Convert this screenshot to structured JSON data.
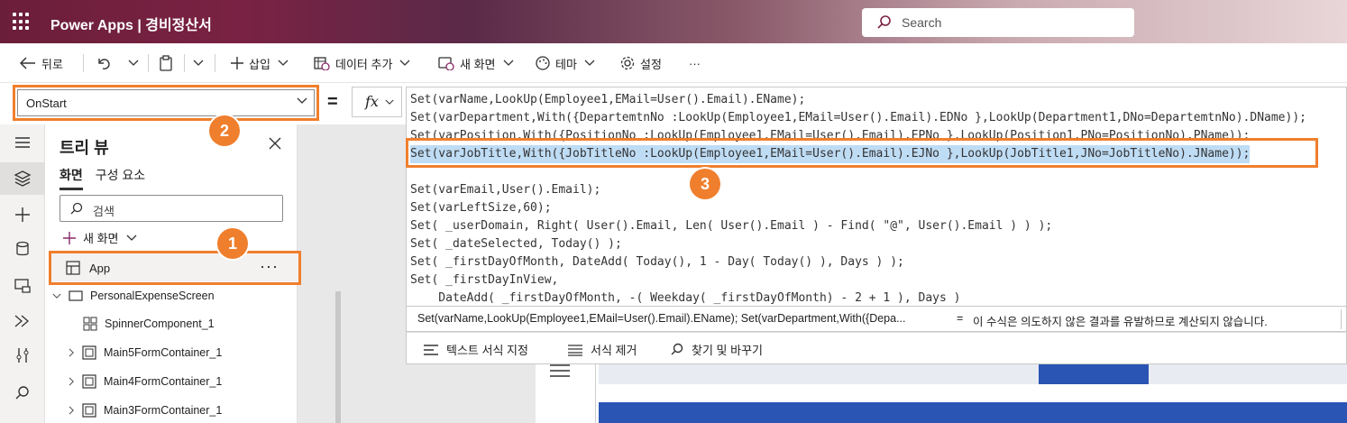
{
  "header": {
    "app_name": "Power Apps  |  경비정산서",
    "search_placeholder": "Search"
  },
  "toolbar": {
    "back": "뒤로",
    "insert": "삽입",
    "add_data": "데이터 추가",
    "new_screen": "새 화면",
    "theme": "테마",
    "settings": "설정",
    "more": "···"
  },
  "formula": {
    "property": "OnStart",
    "equals": "=",
    "fx": "fx"
  },
  "tree": {
    "title": "트리 뷰",
    "tab_screens": "화면",
    "tab_components": "구성 요소",
    "search_placeholder": "검색",
    "new_screen": "새 화면",
    "app_node": "App",
    "app_more": "···",
    "nodes": [
      "PersonalExpenseScreen",
      "SpinnerComponent_1",
      "Main5FormContainer_1",
      "Main4FormContainer_1",
      "Main3FormContainer_1"
    ]
  },
  "code": {
    "lines": [
      "Set(varName,LookUp(Employee1,EMail=User().Email).EName);",
      "Set(varDepartment,With({DepartemtnNo :LookUp(Employee1,EMail=User().Email).EDNo },LookUp(Department1,DNo=DepartemtnNo).DName));",
      "Set(varPosition,With({PositionNo :LookUp(Employee1,EMail=User().Email).EPNo },LookUp(Position1,PNo=PositionNo).PName));",
      "Set(varJobTitle,With({JobTitleNo :LookUp(Employee1,EMail=User().Email).EJNo },LookUp(JobTitle1,JNo=JobTitleNo).JName));",
      "",
      "Set(varEmail,User().Email);",
      "Set(varLeftSize,60);",
      "Set( _userDomain, Right( User().Email, Len( User().Email ) - Find( \"@\", User().Email ) ) );",
      "Set( _dateSelected, Today() );",
      "Set( _firstDayOfMonth, DateAdd( Today(), 1 - Day( Today() ), Days ) );",
      "Set( _firstDayInView,",
      "    DateAdd( _firstDayOfMonth, -( Weekday( _firstDayOfMonth) - 2 + 1 ), Days )"
    ]
  },
  "result": {
    "expression": "Set(varName,LookUp(Employee1,EMail=User().Email).EName); Set(varDepartment,With({Depa...",
    "equals": "=",
    "message": "이 수식은 의도하지 않은 결과를 유발하므로 계산되지 않습니다."
  },
  "format_bar": {
    "format_text": "텍스트 서식 지정",
    "remove_format": "서식 제거",
    "find_replace": "찾기 및 바꾸기"
  },
  "badges": [
    "1",
    "2",
    "3"
  ],
  "colors": {
    "accent_orange": "#f07f2d",
    "header_start": "#6b1e3a",
    "highlight": "#bfdcf5",
    "app_blue": "#2b55b4"
  }
}
